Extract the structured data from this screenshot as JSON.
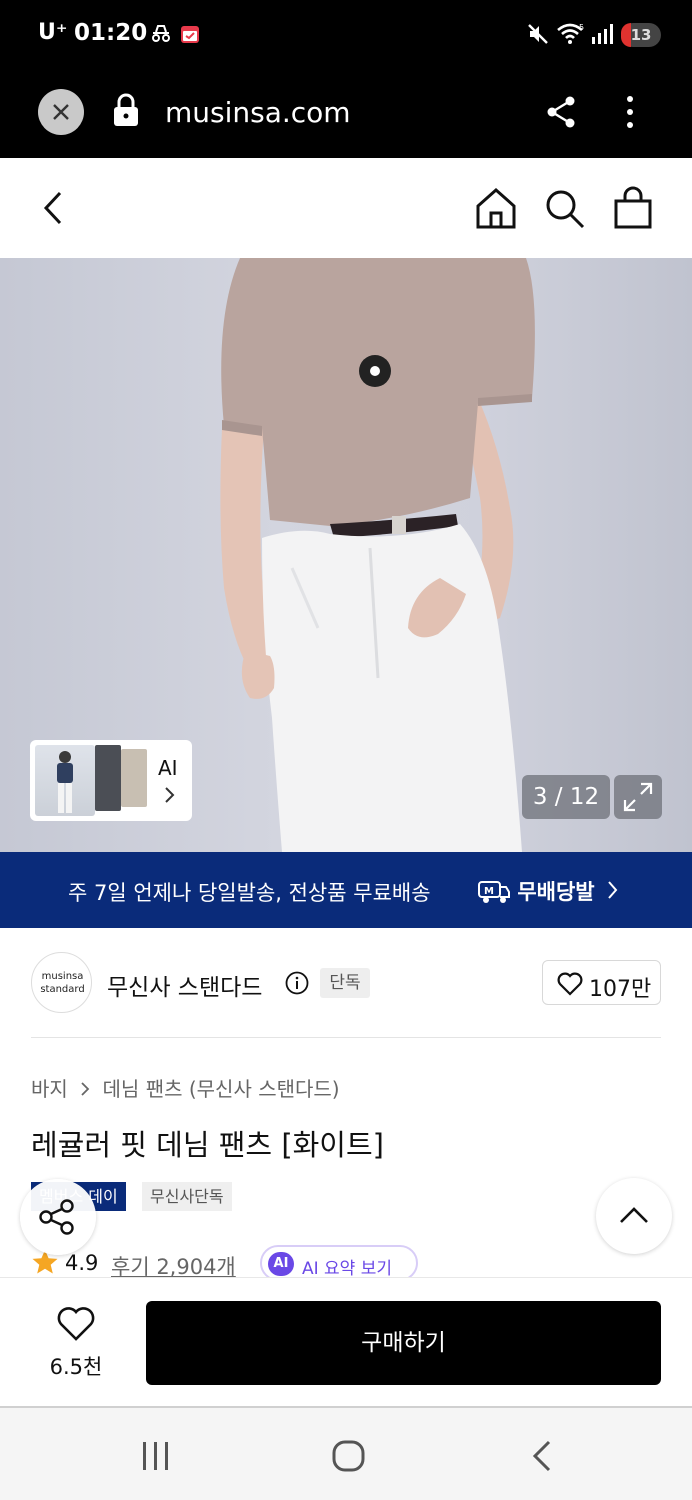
{
  "status_bar": {
    "carrier": "U⁺",
    "time": "01:20",
    "battery": "13"
  },
  "browser": {
    "url": "musinsa.com"
  },
  "gallery": {
    "counter": "3 / 12",
    "ai_label": "AI"
  },
  "banner": {
    "text": "주 7일 언제나 당일발송, 전상품 무료배송",
    "logo_text": "무배당발"
  },
  "brand": {
    "logo_line1": "musinsa",
    "logo_line2": "standard",
    "name": "무신사 스탠다드",
    "badge": "단독",
    "likes": "107만"
  },
  "product": {
    "breadcrumb": [
      "바지",
      "데님 팬츠 (무신사 스탠다드)"
    ],
    "title": "레귤러 핏 데님 팬츠 [화이트]",
    "tags": [
      "멤버스 데이",
      "무신사단독"
    ],
    "rating": "4.9",
    "reviews": "후기 2,904개",
    "ai_summary_badge": "AI",
    "ai_summary": "AI 요약 보기"
  },
  "buy_bar": {
    "wish_count": "6.5천",
    "buy_label": "구매하기"
  },
  "colors": {
    "navy": "#0a2b7a",
    "ai_purple": "#6a48e6",
    "star": "#f5a623"
  }
}
